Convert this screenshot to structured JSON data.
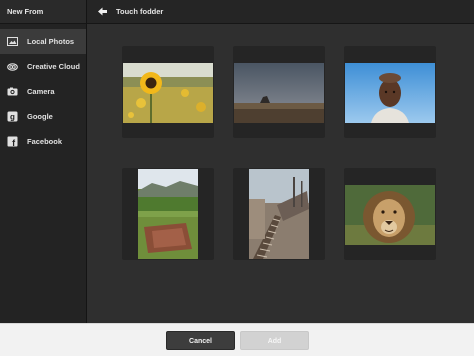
{
  "sidebar": {
    "title": "New From",
    "items": [
      {
        "label": "Local Photos",
        "icon": "photo-icon",
        "active": true
      },
      {
        "label": "Creative Cloud",
        "icon": "creative-cloud-icon",
        "active": false
      },
      {
        "label": "Camera",
        "icon": "camera-icon",
        "active": false
      },
      {
        "label": "Google",
        "icon": "google-icon",
        "active": false
      },
      {
        "label": "Facebook",
        "icon": "facebook-icon",
        "active": false
      }
    ]
  },
  "main": {
    "back_icon": "arrow-left-icon",
    "folder_title": "Touch fodder",
    "photos": [
      {
        "subject": "sunflower-field",
        "orientation": "landscape"
      },
      {
        "subject": "desert-butte",
        "orientation": "landscape"
      },
      {
        "subject": "child-portrait",
        "orientation": "landscape"
      },
      {
        "subject": "farmland-valley",
        "orientation": "portrait"
      },
      {
        "subject": "shipwreck-dock",
        "orientation": "portrait"
      },
      {
        "subject": "lion",
        "orientation": "landscape"
      }
    ]
  },
  "footer": {
    "cancel_label": "Cancel",
    "add_label": "Add",
    "add_enabled": false
  },
  "colors": {
    "sidebar_bg": "#232323",
    "main_bg": "#2f2f2f",
    "active_item_bg": "#3b3b3b",
    "cancel_bg": "#3d3d3d",
    "add_disabled_bg": "#d2d2d2"
  }
}
